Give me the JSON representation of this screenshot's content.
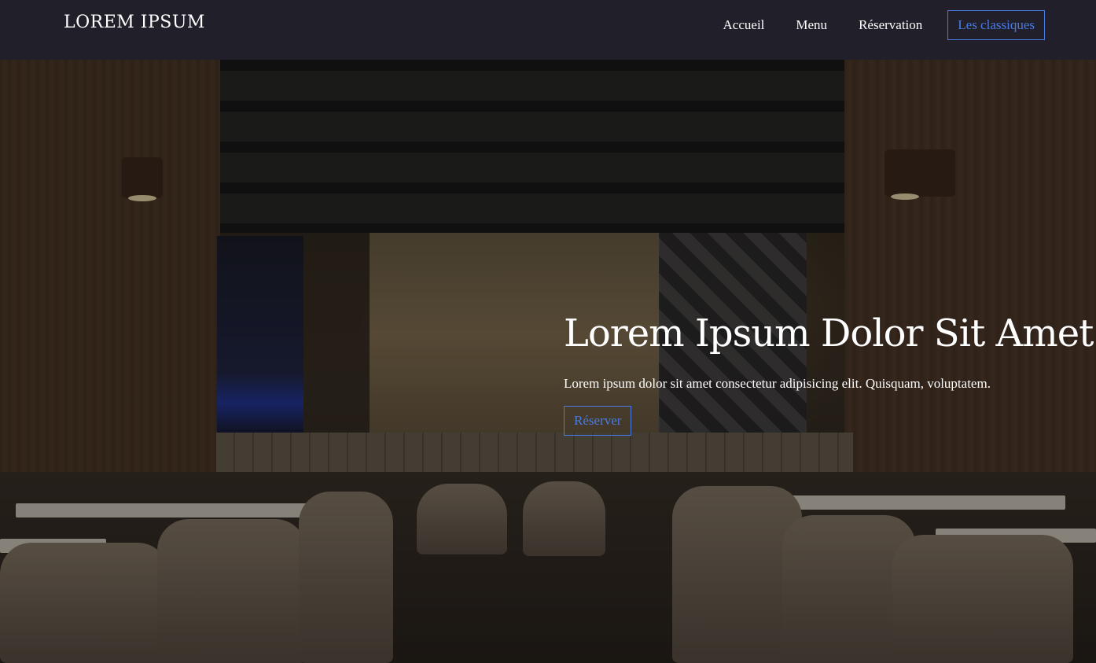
{
  "header": {
    "brand": "LOREM IPSUM",
    "nav": [
      {
        "label": "Accueil"
      },
      {
        "label": "Menu"
      },
      {
        "label": "Réservation"
      }
    ],
    "cta_label": "Les classiques"
  },
  "hero": {
    "title": "Lorem Ipsum Dolor Sit Amet.",
    "text": "Lorem ipsum dolor sit amet consectetur adipisicing elit. Quisquam, voluptatem.",
    "button_label": "Réserver",
    "background": "restaurant-interior-image"
  },
  "colors": {
    "accent": "#4a7be3",
    "header_bg": "#22212c",
    "text": "#ffffff"
  }
}
